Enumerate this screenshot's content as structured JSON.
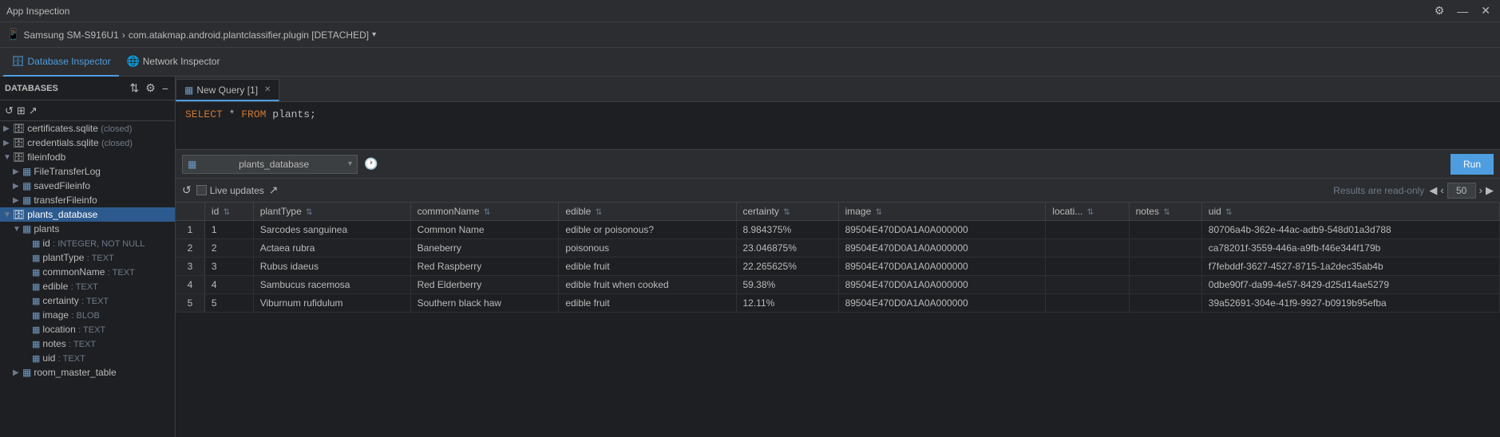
{
  "titleBar": {
    "title": "App Inspection",
    "settingsIcon": "⚙",
    "minimizeIcon": "—",
    "closeIcon": "✕"
  },
  "deviceBar": {
    "icon": "📱",
    "deviceName": "Samsung SM-S916U1",
    "separator": ">",
    "processName": "com.atakmap.android.plantclassifier.plugin [DETACHED]",
    "chevron": "▾"
  },
  "inspectorTabs": [
    {
      "id": "database",
      "label": "Database Inspector",
      "icon": "🗄",
      "active": true
    },
    {
      "id": "network",
      "label": "Network Inspector",
      "icon": "🌐",
      "active": false
    }
  ],
  "sidebar": {
    "header": "Databases",
    "tools": {
      "filter": "⇅",
      "settings": "⚙",
      "minus": "−"
    },
    "actions": {
      "refresh": "↺",
      "expandAll": "⊞",
      "export": "↗"
    },
    "tree": [
      {
        "id": "certificates",
        "indent": 0,
        "expand": false,
        "icon": "🗄",
        "text": "certificates.sqlite",
        "suffix": "(closed)",
        "type": "db"
      },
      {
        "id": "credentials",
        "indent": 0,
        "expand": false,
        "icon": "🗄",
        "text": "credentials.sqlite",
        "suffix": "(closed)",
        "type": "db"
      },
      {
        "id": "fileinfodb",
        "indent": 0,
        "expand": true,
        "icon": "🗄",
        "text": "fileinfodb",
        "type": "db"
      },
      {
        "id": "FileTransferLog",
        "indent": 1,
        "expand": false,
        "icon": "▦",
        "text": "FileTransferLog",
        "type": "table"
      },
      {
        "id": "savedFileinfo",
        "indent": 1,
        "expand": false,
        "icon": "▦",
        "text": "savedFileinfo",
        "type": "table"
      },
      {
        "id": "transferFileinfo",
        "indent": 1,
        "expand": false,
        "icon": "▦",
        "text": "transferFileinfo",
        "type": "table"
      },
      {
        "id": "plants_database",
        "indent": 0,
        "expand": true,
        "icon": "🗄",
        "text": "plants_database",
        "type": "db",
        "selected": true
      },
      {
        "id": "plants_table",
        "indent": 1,
        "expand": true,
        "icon": "▦",
        "text": "plants",
        "type": "table"
      },
      {
        "id": "field_id",
        "indent": 2,
        "icon": "▦",
        "text": "id",
        "fieldType": ": INTEGER, NOT NULL",
        "type": "field"
      },
      {
        "id": "field_plantType",
        "indent": 2,
        "icon": "▦",
        "text": "plantType",
        "fieldType": ": TEXT",
        "type": "field"
      },
      {
        "id": "field_commonName",
        "indent": 2,
        "icon": "▦",
        "text": "commonName",
        "fieldType": ": TEXT",
        "type": "field"
      },
      {
        "id": "field_edible",
        "indent": 2,
        "icon": "▦",
        "text": "edible",
        "fieldType": ": TEXT",
        "type": "field"
      },
      {
        "id": "field_certainty",
        "indent": 2,
        "icon": "▦",
        "text": "certainty",
        "fieldType": ": TEXT",
        "type": "field"
      },
      {
        "id": "field_image",
        "indent": 2,
        "icon": "▦",
        "text": "image",
        "fieldType": ": BLOB",
        "type": "field"
      },
      {
        "id": "field_location",
        "indent": 2,
        "icon": "▦",
        "text": "location",
        "fieldType": ": TEXT",
        "type": "field"
      },
      {
        "id": "field_notes",
        "indent": 2,
        "icon": "▦",
        "text": "notes",
        "fieldType": ": TEXT",
        "type": "field"
      },
      {
        "id": "field_uid",
        "indent": 2,
        "icon": "▦",
        "text": "uid",
        "fieldType": ": TEXT",
        "type": "field"
      },
      {
        "id": "room_master_table",
        "indent": 1,
        "expand": false,
        "icon": "▦",
        "text": "room_master_table",
        "type": "table"
      }
    ]
  },
  "queryEditor": {
    "tabLabel": "New Query [1]",
    "tabIcon": "▦",
    "sqlText": "SELECT * FROM plants;"
  },
  "dbSelector": {
    "selectedDb": "plants_database",
    "icon": "▦"
  },
  "resultsToolbar": {
    "refreshLabel": "↺",
    "liveUpdatesLabel": "Live updates",
    "exportIcon": "↗",
    "readOnlyText": "Results are read-only",
    "pageSize": "50",
    "prevPageIcon": "◀",
    "prevIcon": "‹",
    "nextIcon": "›",
    "nextPageIcon": "▶"
  },
  "runButton": "Run",
  "tableColumns": [
    {
      "id": "row-num",
      "label": ""
    },
    {
      "id": "id",
      "label": "id"
    },
    {
      "id": "plantType",
      "label": "plantType"
    },
    {
      "id": "commonName",
      "label": "commonName"
    },
    {
      "id": "edible",
      "label": "edible"
    },
    {
      "id": "certainty",
      "label": "certainty"
    },
    {
      "id": "image",
      "label": "image"
    },
    {
      "id": "locati",
      "label": "locati..."
    },
    {
      "id": "notes",
      "label": "notes"
    },
    {
      "id": "uid",
      "label": "uid"
    }
  ],
  "tableRows": [
    {
      "rowNum": "1",
      "id": "1",
      "plantType": "Sarcodes sanguinea",
      "commonName": "Common Name",
      "edible": "edible or poisonous?",
      "certainty": "8.984375%",
      "image": "89504E470D0A1A0A000000",
      "location": "",
      "notes": "",
      "uid": "80706a4b-362e-44ac-adb9-548d01a3d788"
    },
    {
      "rowNum": "2",
      "id": "2",
      "plantType": "Actaea rubra",
      "commonName": "Baneberry",
      "edible": "poisonous",
      "certainty": "23.046875%",
      "image": "89504E470D0A1A0A000000",
      "location": "",
      "notes": "",
      "uid": "ca78201f-3559-446a-a9fb-f46e344f179b"
    },
    {
      "rowNum": "3",
      "id": "3",
      "plantType": "Rubus idaeus",
      "commonName": "Red Raspberry",
      "edible": "edible fruit",
      "certainty": "22.265625%",
      "image": "89504E470D0A1A0A000000",
      "location": "",
      "notes": "",
      "uid": "f7febddf-3627-4527-8715-1a2dec35ab4b"
    },
    {
      "rowNum": "4",
      "id": "4",
      "plantType": "Sambucus racemosa",
      "commonName": "Red Elderberry",
      "edible": "edible fruit when cooked",
      "certainty": "59.38%",
      "image": "89504E470D0A1A0A000000",
      "location": "",
      "notes": "",
      "uid": "0dbe90f7-da99-4e57-8429-d25d14ae5279"
    },
    {
      "rowNum": "5",
      "id": "5",
      "plantType": "Viburnum rufidulum",
      "commonName": "Southern black haw",
      "edible": "edible fruit",
      "certainty": "12.11%",
      "image": "89504E470D0A1A0A000000",
      "location": "",
      "notes": "",
      "uid": "39a52691-304e-41f9-9927-b0919b95efba"
    }
  ]
}
